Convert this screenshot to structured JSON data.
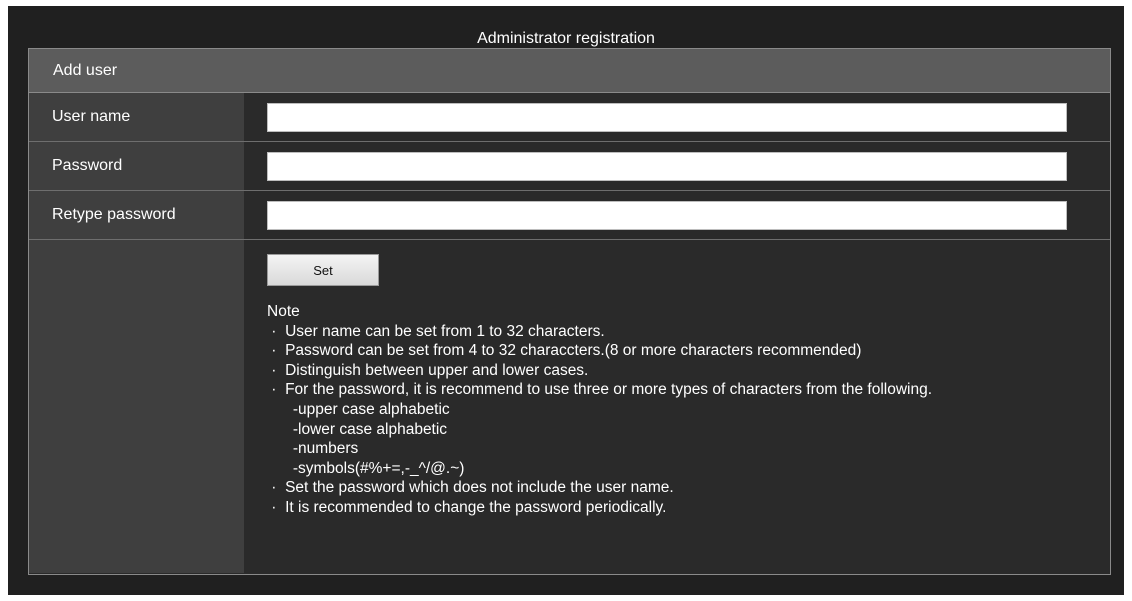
{
  "page": {
    "title": "Administrator registration"
  },
  "panel": {
    "header": "Add user",
    "fields": [
      {
        "label": "User name",
        "value": "",
        "placeholder": ""
      },
      {
        "label": "Password",
        "value": "",
        "placeholder": ""
      },
      {
        "label": "Retype password",
        "value": "",
        "placeholder": ""
      }
    ],
    "set_label": "Set"
  },
  "note": {
    "heading": "Note",
    "lines": [
      " ·  User name can be set from 1 to 32 characters.",
      " ·  Password can be set from 4 to 32 characcters.(8 or more characters recommended)",
      " ·  Distinguish between upper and lower cases.",
      " ·  For the password, it is recommend to use three or more types of characters from the following.",
      "      -upper case alphabetic",
      "      -lower case alphabetic",
      "      -numbers",
      "      -symbols(#%+=,-_^/@.~)",
      " ·  Set the password which does not include the user name.",
      " ·  It is recommended to change the password periodically."
    ]
  },
  "colors": {
    "background": "#202020",
    "header": "#5c5c5c",
    "label_column": "#3f3f3f",
    "field_column": "#2a2a2a",
    "border": "#8a8a8a"
  }
}
